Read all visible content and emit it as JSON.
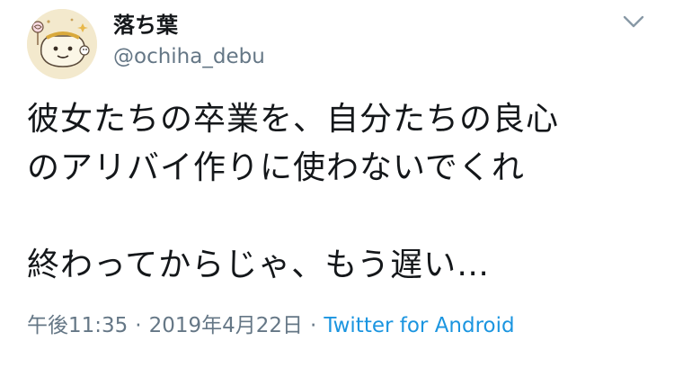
{
  "user": {
    "display_name": "落ち葉",
    "handle": "@ochiha_debu"
  },
  "tweet": {
    "lines": [
      "彼女たちの卒業を、自分たちの良心",
      "のアリバイ作りに使わないでくれ",
      "",
      "終わってからじゃ、もう遅い…"
    ]
  },
  "meta": {
    "time": "午後11:35",
    "separator": "·",
    "date": "2019年4月22日",
    "source": "Twitter for Android"
  },
  "icons": {
    "menu": "chevron-down-icon",
    "avatar": "avatar-image"
  },
  "colors": {
    "text": "#14171a",
    "secondary": "#657786",
    "link": "#1b95e0"
  }
}
